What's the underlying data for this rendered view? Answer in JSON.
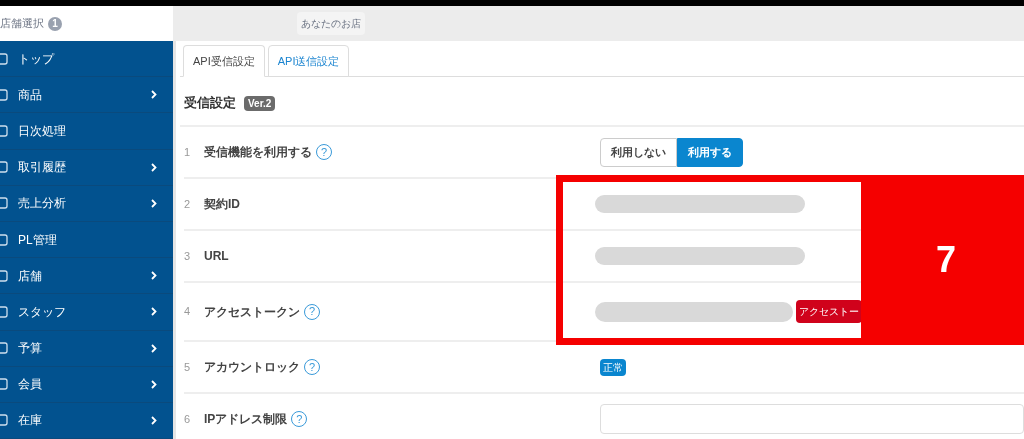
{
  "header": {
    "store_select": "店舗選択",
    "store_count": "1",
    "store_name": "あなたのお店"
  },
  "sidebar": {
    "items": [
      {
        "label": "トップ",
        "expandable": false
      },
      {
        "label": "商品",
        "expandable": true
      },
      {
        "label": "日次処理",
        "expandable": false
      },
      {
        "label": "取引履歴",
        "expandable": true
      },
      {
        "label": "売上分析",
        "expandable": true
      },
      {
        "label": "PL管理",
        "expandable": false
      },
      {
        "label": "店舗",
        "expandable": true
      },
      {
        "label": "スタッフ",
        "expandable": true
      },
      {
        "label": "予算",
        "expandable": true
      },
      {
        "label": "会員",
        "expandable": true
      },
      {
        "label": "在庫",
        "expandable": true
      }
    ]
  },
  "tabs": [
    {
      "label": "API受信設定",
      "selected": true
    },
    {
      "label": "API送信設定",
      "selected": false
    }
  ],
  "section": {
    "title": "受信設定",
    "version": "Ver.2"
  },
  "rows": [
    {
      "number": "1",
      "label": "受信機能を利用する",
      "help": "?",
      "kind": "toggle",
      "options": [
        {
          "label": "利用しない",
          "selected": false
        },
        {
          "label": "利用する",
          "selected": true
        }
      ]
    },
    {
      "number": "2",
      "label": "契約ID",
      "kind": "redacted"
    },
    {
      "number": "3",
      "label": "URL",
      "kind": "redacted"
    },
    {
      "number": "4",
      "label": "アクセストークン",
      "help": "?",
      "kind": "redacted_button",
      "button": "アクセストー"
    },
    {
      "number": "5",
      "label": "アカウントロック",
      "help": "?",
      "kind": "badge",
      "badge": "正常"
    },
    {
      "number": "6",
      "label": "IPアドレス制限",
      "help": "?",
      "kind": "input"
    }
  ],
  "annotation": {
    "label": "7"
  }
}
